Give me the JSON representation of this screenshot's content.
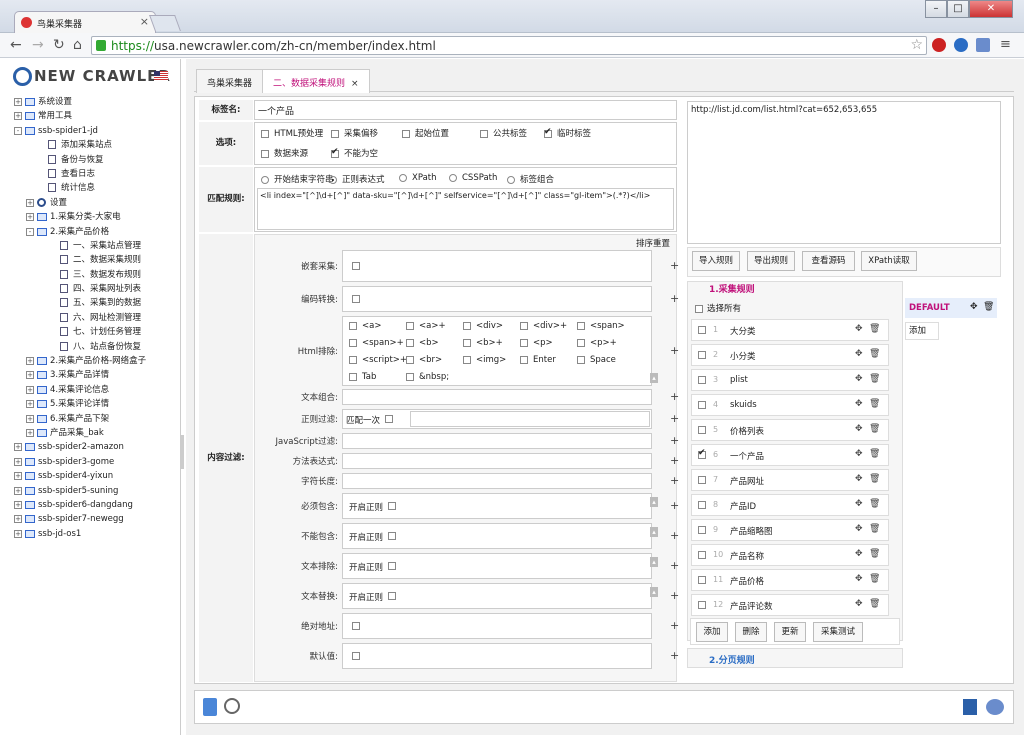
{
  "browser": {
    "tab_title": "鸟巢采集器",
    "url_scheme": "https://",
    "url_rest": "usa.newcrawler.com/zh-cn/member/index.html"
  },
  "brand": {
    "logo_text": "NEW CRAWLER"
  },
  "tree": [
    {
      "label": "系统设置",
      "indent": 0,
      "icon": "folder",
      "pm": "+"
    },
    {
      "label": "常用工具",
      "indent": 0,
      "icon": "folder",
      "pm": "+"
    },
    {
      "label": "ssb-spider1-jd",
      "indent": 0,
      "icon": "folder",
      "pm": "-"
    },
    {
      "label": "添加采集站点",
      "indent": 1,
      "icon": "doc"
    },
    {
      "label": "备份与恢复",
      "indent": 1,
      "icon": "doc"
    },
    {
      "label": "查看日志",
      "indent": 1,
      "icon": "doc"
    },
    {
      "label": "统计信息",
      "indent": 1,
      "icon": "doc"
    },
    {
      "label": "设置",
      "indent": 1,
      "icon": "gear",
      "pm": "+"
    },
    {
      "label": "1.采集分类-大家电",
      "indent": 1,
      "icon": "folder",
      "pm": "+"
    },
    {
      "label": "2.采集产品价格",
      "indent": 1,
      "icon": "folder",
      "pm": "-"
    },
    {
      "label": "一、采集站点管理",
      "indent": 2,
      "icon": "doc"
    },
    {
      "label": "二、数据采集规则",
      "indent": 2,
      "icon": "doc"
    },
    {
      "label": "三、数据发布规则",
      "indent": 2,
      "icon": "doc"
    },
    {
      "label": "四、采集网址列表",
      "indent": 2,
      "icon": "doc"
    },
    {
      "label": "五、采集到的数据",
      "indent": 2,
      "icon": "doc"
    },
    {
      "label": "六、网址检测管理",
      "indent": 2,
      "icon": "doc"
    },
    {
      "label": "七、计划任务管理",
      "indent": 2,
      "icon": "doc"
    },
    {
      "label": "八、站点备份恢复",
      "indent": 2,
      "icon": "doc"
    },
    {
      "label": "2.采集产品价格-网络盒子",
      "indent": 1,
      "icon": "folder",
      "pm": "+"
    },
    {
      "label": "3.采集产品详情",
      "indent": 1,
      "icon": "folder",
      "pm": "+"
    },
    {
      "label": "4.采集评论信息",
      "indent": 1,
      "icon": "folder",
      "pm": "+"
    },
    {
      "label": "5.采集评论详情",
      "indent": 1,
      "icon": "folder",
      "pm": "+"
    },
    {
      "label": "6.采集产品下架",
      "indent": 1,
      "icon": "folder",
      "pm": "+"
    },
    {
      "label": "产品采集_bak",
      "indent": 1,
      "icon": "folder",
      "pm": "+"
    },
    {
      "label": "ssb-spider2-amazon",
      "indent": 0,
      "icon": "folder",
      "pm": "+"
    },
    {
      "label": "ssb-spider3-gome",
      "indent": 0,
      "icon": "folder",
      "pm": "+"
    },
    {
      "label": "ssb-spider4-yixun",
      "indent": 0,
      "icon": "folder",
      "pm": "+"
    },
    {
      "label": "ssb-spider5-suning",
      "indent": 0,
      "icon": "folder",
      "pm": "+"
    },
    {
      "label": "ssb-spider6-dangdang",
      "indent": 0,
      "icon": "folder",
      "pm": "+"
    },
    {
      "label": "ssb-spider7-newegg",
      "indent": 0,
      "icon": "folder",
      "pm": "+"
    },
    {
      "label": "ssb-jd-os1",
      "indent": 0,
      "icon": "folder",
      "pm": "+"
    }
  ],
  "tabs": [
    {
      "label": "鸟巢采集器"
    },
    {
      "label": "二、数据采集规则",
      "close": "×"
    }
  ],
  "form": {
    "tag_name_label": "标签名:",
    "tag_name_value": "一个产品",
    "options_label": "选项:",
    "options": [
      {
        "label": "HTML预处理",
        "checked": false
      },
      {
        "label": "采集偏移",
        "checked": false
      },
      {
        "label": "起始位置",
        "checked": false
      },
      {
        "label": "公共标签",
        "checked": false
      },
      {
        "label": "临时标签",
        "checked": true
      },
      {
        "label": "数据来源",
        "checked": false
      },
      {
        "label": "不能为空",
        "checked": true
      }
    ],
    "match_label": "匹配规则:",
    "match_modes": [
      {
        "label": "开始结束字符串",
        "checked": false
      },
      {
        "label": "正则表达式",
        "checked": true
      },
      {
        "label": "XPath",
        "checked": false
      },
      {
        "label": "CSSPath",
        "checked": false
      },
      {
        "label": "标签组合",
        "checked": false
      }
    ],
    "match_value": "<li index=\"[^]\\d+[^]\" data-sku=\"[^]\\d+[^]\" selfservice=\"[^]\\d+[^]\" class=\"gl-item\">(.*?)</li>",
    "content_filter_label": "内容过滤:",
    "sort_reset": "排序重置",
    "nested_label": "嵌套采集:",
    "encode_label": "编码转换:",
    "html_exclude_label": "Html排除:",
    "html_tags": [
      "<a>",
      "<a>+",
      "<div>",
      "<div>+",
      "<span>",
      "<span>+",
      "<b>",
      "<b>+",
      "<p>",
      "<p>+",
      "<script>+",
      "<br>",
      "<img>",
      "Enter",
      "Space",
      "Tab",
      "&nbsp;"
    ],
    "text_combine_label": "文本组合:",
    "regex_filter_label": "正则过滤:",
    "match_once": "匹配一次",
    "js_filter_label": "JavaScript过滤:",
    "method_expr_label": "方法表达式:",
    "char_len_label": "字符长度:",
    "must_contain_label": "必须包含:",
    "not_contain_label": "不能包含:",
    "text_exclude_label": "文本排除:",
    "text_replace_label": "文本替换:",
    "enable_regex": "开启正则",
    "absolute_url_label": "绝对地址:",
    "default_value_label": "默认值:",
    "plus": "+"
  },
  "right": {
    "url_text": "http://list.jd.com/list.html?cat=652,653,655",
    "buttons": [
      "导入规则",
      "导出规则",
      "查看源码",
      "XPath读取"
    ],
    "section1": "1.采集规则",
    "select_all": "选择所有",
    "rules": [
      {
        "n": "1",
        "name": "大分类",
        "checked": false
      },
      {
        "n": "2",
        "name": "小分类",
        "checked": false
      },
      {
        "n": "3",
        "name": "plist",
        "checked": false
      },
      {
        "n": "4",
        "name": "skuids",
        "checked": false
      },
      {
        "n": "5",
        "name": "价格列表",
        "checked": false
      },
      {
        "n": "6",
        "name": "一个产品",
        "checked": true
      },
      {
        "n": "7",
        "name": "产品网址",
        "checked": false
      },
      {
        "n": "8",
        "name": "产品ID",
        "checked": false
      },
      {
        "n": "9",
        "name": "产品缩略图",
        "checked": false
      },
      {
        "n": "10",
        "name": "产品名称",
        "checked": false
      },
      {
        "n": "11",
        "name": "产品价格",
        "checked": false
      },
      {
        "n": "12",
        "name": "产品评论数",
        "checked": false
      }
    ],
    "rule_buttons": [
      "添加",
      "删除",
      "更新",
      "采集测试"
    ],
    "section2": "2.分页规则",
    "default_label": "DEFAULT",
    "add_label": "添加"
  },
  "colors": {
    "accent": "#c0107a",
    "section2": "#2a6cc4"
  }
}
